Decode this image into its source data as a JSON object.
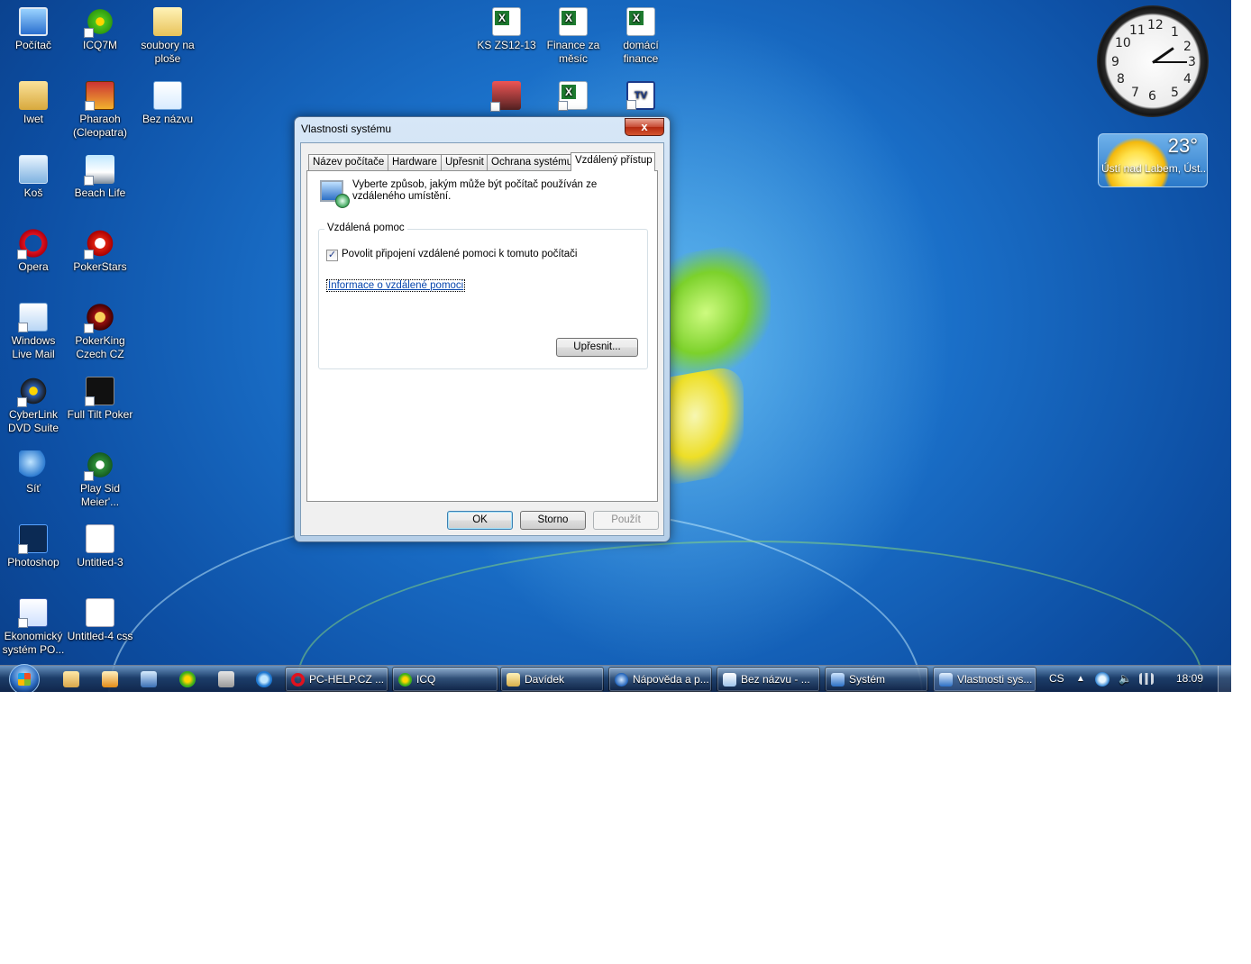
{
  "desktop": {
    "icons": [
      {
        "label": "Počítač",
        "icon": "computer-icon"
      },
      {
        "label": "ICQ7M",
        "icon": "icq-icon"
      },
      {
        "label": "soubory na ploše",
        "icon": "folder-icon"
      },
      {
        "label": "Iwet",
        "icon": "user-folder-icon"
      },
      {
        "label": "Pharaoh (Cleopatra)",
        "icon": "pharaoh-icon"
      },
      {
        "label": "Bez názvu",
        "icon": "paint-icon"
      },
      {
        "label": "Koš",
        "icon": "recycle-bin-icon"
      },
      {
        "label": "Beach Life",
        "icon": "beach-life-icon"
      },
      {
        "label": "Opera",
        "icon": "opera-icon"
      },
      {
        "label": "PokerStars",
        "icon": "pokerstars-icon"
      },
      {
        "label": "Windows Live Mail",
        "icon": "mail-icon"
      },
      {
        "label": "PokerKing Czech CZ",
        "icon": "pokerking-icon"
      },
      {
        "label": "CyberLink DVD Suite",
        "icon": "cyberlink-icon"
      },
      {
        "label": "Full Tilt Poker",
        "icon": "full-tilt-icon"
      },
      {
        "label": "Síť",
        "icon": "network-icon"
      },
      {
        "label": "Play Sid Meier'...",
        "icon": "sid-meier-icon"
      },
      {
        "label": "Photoshop",
        "icon": "photoshop-icon"
      },
      {
        "label": "Untitled-3",
        "icon": "document-icon"
      },
      {
        "label": "Ekonomický systém PO...",
        "icon": "economic-system-icon"
      },
      {
        "label": "Untitled-4 css",
        "icon": "css-document-icon"
      },
      {
        "label": "KS ZS12-13",
        "icon": "excel-icon"
      },
      {
        "label": "Finance za měsíc",
        "icon": "excel-icon"
      },
      {
        "label": "domácí finance",
        "icon": "excel-icon"
      }
    ]
  },
  "gadgets": {
    "clock": {
      "numbers": [
        "12",
        "1",
        "2",
        "3",
        "4",
        "5",
        "6",
        "7",
        "8",
        "9",
        "10",
        "11"
      ],
      "time_shown": "1:50"
    },
    "weather": {
      "temperature": "23°",
      "location": "Ústí nad Labem, Úst..."
    }
  },
  "dialog": {
    "title": "Vlastnosti systému",
    "close_label": "x",
    "tabs": [
      "Název počítače",
      "Hardware",
      "Upřesnit",
      "Ochrana systému",
      "Vzdálený přístup"
    ],
    "active_tab": "Vzdálený přístup",
    "intro_text": "Vyberte způsob, jakým může být počítač používán ze vzdáleného umístění.",
    "group_title": "Vzdálená pomoc",
    "checkbox_label": "Povolit připojení vzdálené pomoci k tomuto počítači",
    "checkbox_checked": true,
    "checkbox_mark": "✓",
    "link_text": "Informace o vzdálené pomoci",
    "advanced_button": "Upřesnit...",
    "ok_button": "OK",
    "cancel_button": "Storno",
    "apply_button": "Použít"
  },
  "taskbar": {
    "tasks": [
      {
        "label": "PC-HELP.CZ ...",
        "icon": "opera-icon"
      },
      {
        "label": "ICQ",
        "icon": "icq-icon"
      },
      {
        "label": "Davídek",
        "icon": "folder-icon"
      },
      {
        "label": "Nápověda a p...",
        "icon": "help-icon"
      },
      {
        "label": "Bez názvu - ...",
        "icon": "paint-icon"
      },
      {
        "label": "Systém",
        "icon": "system-icon"
      },
      {
        "label": "Vlastnosti sys...",
        "icon": "system-properties-icon"
      }
    ],
    "language": "CS",
    "time": "18:09"
  },
  "colors": {
    "accent": "#1a6fc8",
    "link": "#0645ad"
  }
}
